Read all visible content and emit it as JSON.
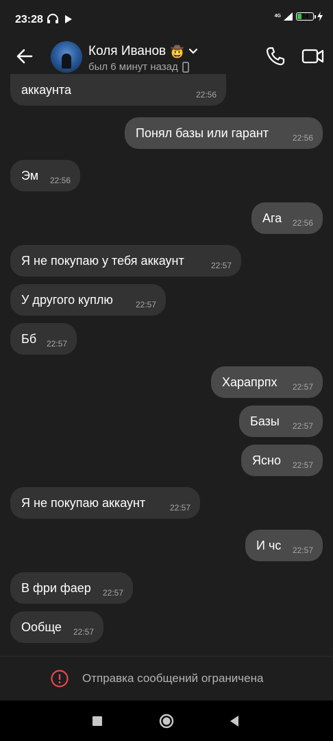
{
  "status_bar": {
    "time": "23:28",
    "network": "4G",
    "battery": "24",
    "battery_level": 0.24
  },
  "header": {
    "contact_name": "Коля Иванов",
    "emoji": "🤠",
    "status": "был 6 минут назад"
  },
  "messages": [
    {
      "side": "in",
      "text": "аккаунта",
      "time": "22:56"
    },
    {
      "side": "out",
      "text": "Понял базы или гарант",
      "time": "22:56"
    },
    {
      "side": "in",
      "text": "Эм",
      "time": "22:56"
    },
    {
      "side": "out",
      "text": "Ага",
      "time": "22:56"
    },
    {
      "side": "in",
      "text": "Я не покупаю у тебя аккаунт",
      "time": "22:57"
    },
    {
      "side": "in",
      "text": "У другого куплю",
      "time": "22:57"
    },
    {
      "side": "in",
      "text": "Бб",
      "time": "22:57"
    },
    {
      "side": "out",
      "text": "Харапрпх",
      "time": "22:57"
    },
    {
      "side": "out",
      "text": "Базы",
      "time": "22:57"
    },
    {
      "side": "out",
      "text": "Ясно",
      "time": "22:57"
    },
    {
      "side": "in",
      "text": "Я не покупаю аккаунт",
      "time": "22:57"
    },
    {
      "side": "out",
      "text": "И чс",
      "time": "22:57"
    },
    {
      "side": "in",
      "text": "В фри фаер",
      "time": "22:57"
    },
    {
      "side": "in",
      "text": "Ообще",
      "time": "22:57"
    }
  ],
  "footer": {
    "restriction_text": "Отправка сообщений ограничена"
  },
  "colors": {
    "background": "#1e1e1e",
    "incoming_bubble": "#333333",
    "outgoing_bubble": "#4a4a4a",
    "warning": "#e5484d"
  }
}
